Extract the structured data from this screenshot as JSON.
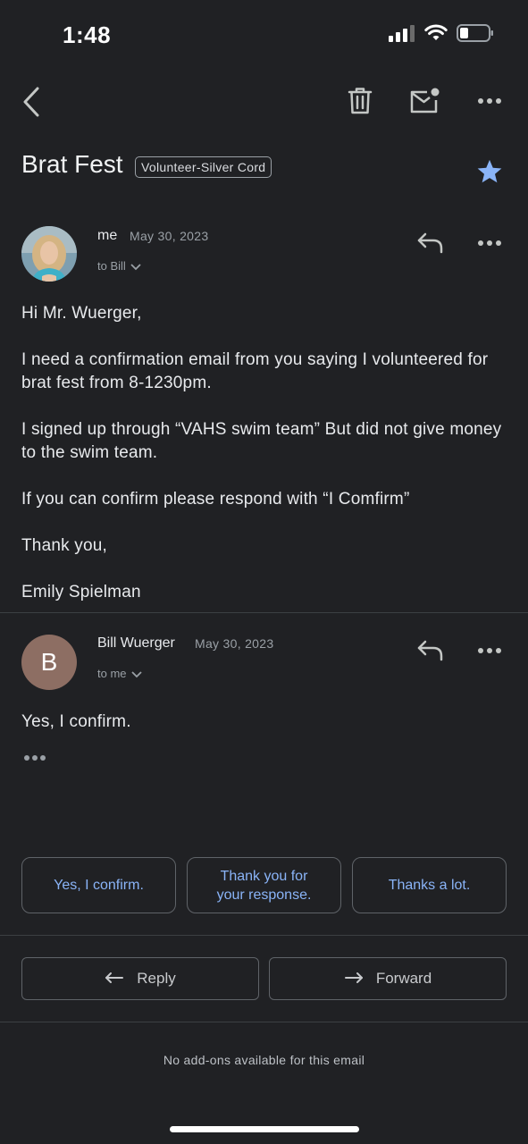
{
  "status_bar": {
    "time": "1:48"
  },
  "toolbar": {
    "back_icon": "chevron-left-icon",
    "delete_icon": "trash-icon",
    "unread_icon": "mail-unread-icon",
    "more_icon": "more-horizontal-icon"
  },
  "header": {
    "subject": "Brat Fest",
    "label": "Volunteer-Silver Cord",
    "starred": true,
    "star_color": "#8ab4f8"
  },
  "messages": [
    {
      "sender": "me",
      "date": "May 30, 2023",
      "to": "to Bill",
      "body": [
        "Hi Mr. Wuerger,",
        "I need a confirmation email from you saying I volunteered for brat fest from 8-1230pm.",
        "I signed up through “VAHS swim team” But did not give money to the swim team.",
        "If you can confirm please respond with “I Comfirm”",
        "Thank you,",
        "Emily Spielman"
      ]
    },
    {
      "sender": "Bill Wuerger",
      "avatar_letter": "B",
      "avatar_color": "#8d6e63",
      "date": "May 30, 2023",
      "to": "to me",
      "body": [
        "Yes, I confirm."
      ]
    }
  ],
  "smart_replies": [
    "Yes, I confirm.",
    "Thank you for your response.",
    "Thanks a lot."
  ],
  "actions": {
    "reply": "Reply",
    "forward": "Forward"
  },
  "addons_text": "No add-ons available for this email"
}
